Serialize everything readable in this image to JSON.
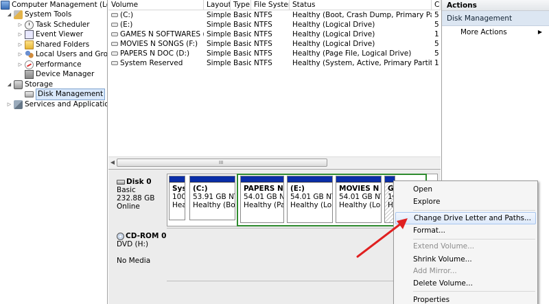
{
  "tree": {
    "root": "Computer Management (Local",
    "system_tools": "System Tools",
    "task_scheduler": "Task Scheduler",
    "event_viewer": "Event Viewer",
    "shared_folders": "Shared Folders",
    "local_users": "Local Users and Groups",
    "performance": "Performance",
    "device_manager": "Device Manager",
    "storage": "Storage",
    "disk_management": "Disk Management",
    "services": "Services and Applications"
  },
  "list": {
    "headers": [
      "Volume",
      "Layout",
      "Type",
      "File System",
      "Status",
      "C"
    ],
    "rows": [
      [
        "(C:)",
        "Simple",
        "Basic",
        "NTFS",
        "Healthy (Boot, Crash Dump, Primary Partition)",
        "5"
      ],
      [
        "(E:)",
        "Simple",
        "Basic",
        "NTFS",
        "Healthy (Logical Drive)",
        "5"
      ],
      [
        "GAMES N SOFTWARES (G:)",
        "Simple",
        "Basic",
        "NTFS",
        "Healthy (Logical Drive)",
        "1"
      ],
      [
        "MOVIES N SONGS (F:)",
        "Simple",
        "Basic",
        "NTFS",
        "Healthy (Logical Drive)",
        "5"
      ],
      [
        "PAPERS N DOC (D:)",
        "Simple",
        "Basic",
        "NTFS",
        "Healthy (Page File, Logical Drive)",
        "5"
      ],
      [
        "System Reserved",
        "Simple",
        "Basic",
        "NTFS",
        "Healthy (System, Active, Primary Partition)",
        "1"
      ]
    ],
    "scroll_grip": "III"
  },
  "disk0": {
    "name": "Disk 0",
    "type": "Basic",
    "size": "232.88 GB",
    "state": "Online",
    "partitions": [
      {
        "name": "Syst",
        "size": "100",
        "status": "Hea"
      },
      {
        "name": "(C:)",
        "size": "53.91 GB NTF:",
        "status": "Healthy (Boot"
      },
      {
        "name": "PAPERS N D",
        "size": "54.01 GB NTF",
        "status": "Healthy (Pag"
      },
      {
        "name": "(E:)",
        "size": "54.01 GB NTF:",
        "status": "Healthy (Logi"
      },
      {
        "name": "MOVIES N SC",
        "size": "54.01 GB NTF:",
        "status": "Healthy (Logi"
      },
      {
        "name": "G",
        "size": "1€",
        "status": "H"
      }
    ]
  },
  "cdrom0": {
    "name": "CD-ROM 0",
    "type": "DVD (H:)",
    "media": "No Media"
  },
  "actions": {
    "header": "Actions",
    "section": "Disk Management",
    "more": "More Actions"
  },
  "context_menu": {
    "items": [
      "Open",
      "Explore",
      "Change Drive Letter and Paths...",
      "Format...",
      "Extend Volume...",
      "Shrink Volume...",
      "Add Mirror...",
      "Delete Volume...",
      "Properties"
    ],
    "highlighted": "Change Drive Letter and Paths...",
    "disabled": [
      "Extend Volume...",
      "Add Mirror..."
    ]
  },
  "colors": {
    "partition_bar": "#0a2ea8",
    "selection_border": "#2d8a2d",
    "annotation_arrow": "#e02020",
    "action_section_bg": "#dce6f2"
  },
  "icons": [
    "computer-icon",
    "tools-icon",
    "clock-icon",
    "event-viewer-icon",
    "shared-folder-icon",
    "users-icon",
    "performance-icon",
    "device-manager-icon",
    "storage-icon",
    "disk-icon",
    "services-icon",
    "volume-icon",
    "cdrom-icon"
  ]
}
